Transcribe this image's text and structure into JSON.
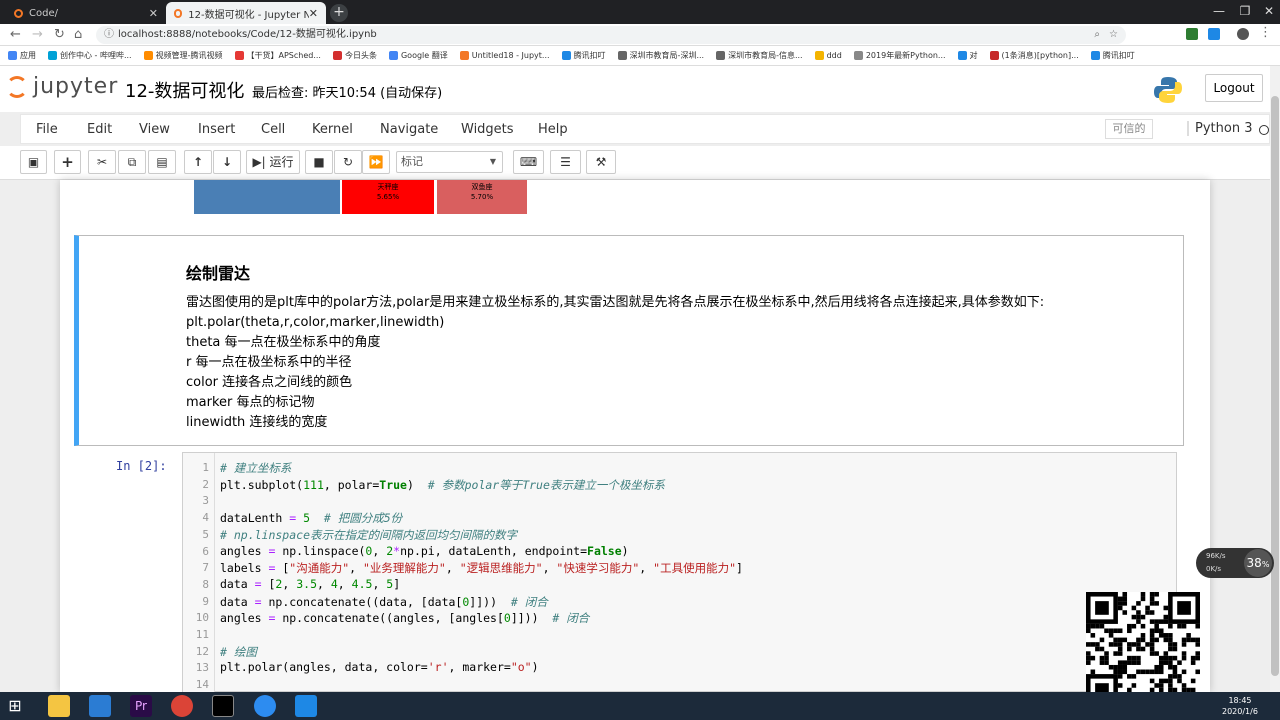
{
  "browser": {
    "tabs": [
      {
        "title": "Code/",
        "active": false
      },
      {
        "title": "12-数据可视化 - Jupyter Notel",
        "active": true
      }
    ],
    "url": "localhost:8888/notebooks/Code/12-数据可视化.ipynb",
    "bookmarks": [
      "应用",
      "创作中心 - 哔哩哔...",
      "视频管理-腾讯视频",
      "【干货】APSched...",
      "今日头条",
      "Google 翻译",
      "Untitled18 - Jupyt...",
      "腾讯扣叮",
      "深圳市教育局-深圳...",
      "深圳市教育局-信息...",
      "ddd",
      "2019年最新Python...",
      "对",
      "(1条消息)[python]...",
      "腾讯扣叮"
    ]
  },
  "jupyter": {
    "logo_text": "jupyter",
    "notebook_title": "12-数据可视化",
    "checkpoint": "最后检查: 昨天10:54  (自动保存)",
    "logout": "Logout",
    "menus": [
      "File",
      "Edit",
      "View",
      "Insert",
      "Cell",
      "Kernel",
      "Navigate",
      "Widgets",
      "Help"
    ],
    "trusted": "可信的",
    "kernel": "Python 3",
    "run_label": "运行",
    "cell_type": "标记"
  },
  "output_bars": [
    {
      "label": "",
      "pct": "",
      "color": "#4a7fb5"
    },
    {
      "label": "天秤座",
      "pct": "5.65%",
      "color": "#ff0000"
    },
    {
      "label": "双鱼座",
      "pct": "5.70%",
      "color": "#d95f5f"
    }
  ],
  "markdown": {
    "heading": "绘制雷达",
    "lines": [
      "雷达图使用的是plt库中的polar方法,polar是用来建立极坐标系的,其实雷达图就是先将各点展示在极坐标系中,然后用线将各点连接起来,具体参数如下:",
      "plt.polar(theta,r,color,marker,linewidth)",
      "theta 每一点在极坐标系中的角度",
      "r 每一点在极坐标系中的半径",
      "color 连接各点之间线的颜色",
      "marker 每点的标记物",
      "linewidth 连接线的宽度"
    ]
  },
  "code_cell": {
    "prompt": "In  [2]:",
    "line_numbers": [
      "1",
      "2",
      "3",
      "4",
      "5",
      "6",
      "7",
      "8",
      "9",
      "10",
      "11",
      "12",
      "13",
      "14"
    ],
    "lines": [
      "# 建立坐标系",
      "plt.subplot(111, polar=True)  # 参数polar等于True表示建立一个极坐标系",
      "",
      "dataLenth = 5  # 把圆分成5份",
      "# np.linspace表示在指定的间隔内返回均匀间隔的数字",
      "angles = np.linspace(0, 2*np.pi, dataLenth, endpoint=False)",
      "labels = [\"沟通能力\", \"业务理解能力\", \"逻辑思维能力\", \"快速学习能力\", \"工具使用能力\"]",
      "data = [2, 3.5, 4, 4.5, 5]",
      "data = np.concatenate((data, [data[0]]))  # 闭合",
      "angles = np.concatenate((angles, [angles[0]]))  # 闭合",
      "",
      "# 绘图",
      "plt.polar(angles, data, color='r', marker=\"o\")",
      ""
    ]
  },
  "speed_widget": {
    "percent": "38",
    "unit": "%",
    "up": "96K/s",
    "down": "0K/s"
  },
  "taskbar": {
    "time": "18:45",
    "date": "2020/1/6"
  }
}
